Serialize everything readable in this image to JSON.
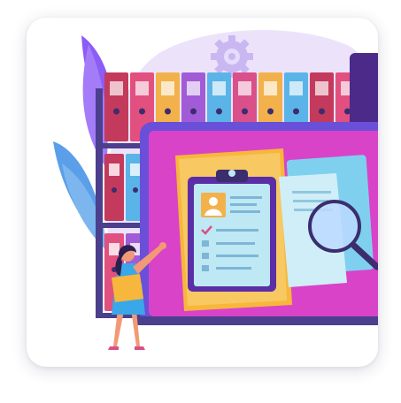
{
  "illustration": {
    "subject": "document-management",
    "colors": {
      "background_blob": "#ece3fb",
      "leaf_purple": "#8b5cf6",
      "leaf_blue": "#5a9fe8",
      "shelf": "#4b3f8e",
      "screen_frame": "#6a4fd9",
      "screen_bg": "#d943c8",
      "folder": "#f6b73c",
      "clipboard": "#5a2ea6",
      "paper": "#bfe8f5",
      "magnifier": "#3b2d6e",
      "person_top": "#3aa7e8",
      "person_skin": "#f29a76",
      "hair": "#2a1f4e"
    },
    "binders": [
      {
        "color": "#c43a5c"
      },
      {
        "color": "#e2507f"
      },
      {
        "color": "#f2b14a"
      },
      {
        "color": "#a25bd6"
      },
      {
        "color": "#5bb4e8"
      },
      {
        "color": "#d9508a"
      },
      {
        "color": "#f2b14a"
      },
      {
        "color": "#5bb4e8"
      },
      {
        "color": "#c43a5c"
      },
      {
        "color": "#e2507f"
      }
    ]
  }
}
